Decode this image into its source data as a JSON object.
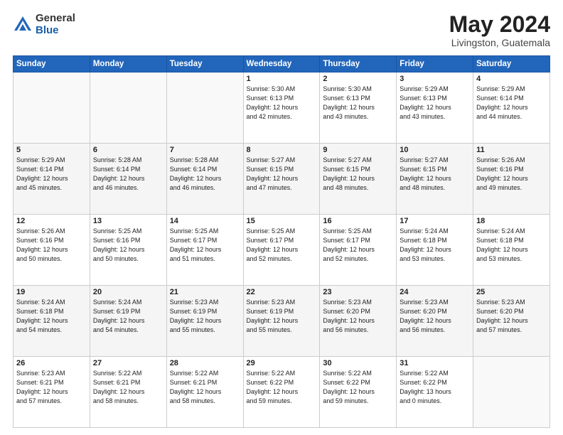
{
  "header": {
    "logo_general": "General",
    "logo_blue": "Blue",
    "month_title": "May 2024",
    "location": "Livingston, Guatemala"
  },
  "weekdays": [
    "Sunday",
    "Monday",
    "Tuesday",
    "Wednesday",
    "Thursday",
    "Friday",
    "Saturday"
  ],
  "weeks": [
    [
      {
        "day": "",
        "info": "",
        "empty": true
      },
      {
        "day": "",
        "info": "",
        "empty": true
      },
      {
        "day": "",
        "info": "",
        "empty": true
      },
      {
        "day": "1",
        "info": "Sunrise: 5:30 AM\nSunset: 6:13 PM\nDaylight: 12 hours\nand 42 minutes."
      },
      {
        "day": "2",
        "info": "Sunrise: 5:30 AM\nSunset: 6:13 PM\nDaylight: 12 hours\nand 43 minutes."
      },
      {
        "day": "3",
        "info": "Sunrise: 5:29 AM\nSunset: 6:13 PM\nDaylight: 12 hours\nand 43 minutes."
      },
      {
        "day": "4",
        "info": "Sunrise: 5:29 AM\nSunset: 6:14 PM\nDaylight: 12 hours\nand 44 minutes."
      }
    ],
    [
      {
        "day": "5",
        "info": "Sunrise: 5:29 AM\nSunset: 6:14 PM\nDaylight: 12 hours\nand 45 minutes."
      },
      {
        "day": "6",
        "info": "Sunrise: 5:28 AM\nSunset: 6:14 PM\nDaylight: 12 hours\nand 46 minutes."
      },
      {
        "day": "7",
        "info": "Sunrise: 5:28 AM\nSunset: 6:14 PM\nDaylight: 12 hours\nand 46 minutes."
      },
      {
        "day": "8",
        "info": "Sunrise: 5:27 AM\nSunset: 6:15 PM\nDaylight: 12 hours\nand 47 minutes."
      },
      {
        "day": "9",
        "info": "Sunrise: 5:27 AM\nSunset: 6:15 PM\nDaylight: 12 hours\nand 48 minutes."
      },
      {
        "day": "10",
        "info": "Sunrise: 5:27 AM\nSunset: 6:15 PM\nDaylight: 12 hours\nand 48 minutes."
      },
      {
        "day": "11",
        "info": "Sunrise: 5:26 AM\nSunset: 6:16 PM\nDaylight: 12 hours\nand 49 minutes."
      }
    ],
    [
      {
        "day": "12",
        "info": "Sunrise: 5:26 AM\nSunset: 6:16 PM\nDaylight: 12 hours\nand 50 minutes."
      },
      {
        "day": "13",
        "info": "Sunrise: 5:25 AM\nSunset: 6:16 PM\nDaylight: 12 hours\nand 50 minutes."
      },
      {
        "day": "14",
        "info": "Sunrise: 5:25 AM\nSunset: 6:17 PM\nDaylight: 12 hours\nand 51 minutes."
      },
      {
        "day": "15",
        "info": "Sunrise: 5:25 AM\nSunset: 6:17 PM\nDaylight: 12 hours\nand 52 minutes."
      },
      {
        "day": "16",
        "info": "Sunrise: 5:25 AM\nSunset: 6:17 PM\nDaylight: 12 hours\nand 52 minutes."
      },
      {
        "day": "17",
        "info": "Sunrise: 5:24 AM\nSunset: 6:18 PM\nDaylight: 12 hours\nand 53 minutes."
      },
      {
        "day": "18",
        "info": "Sunrise: 5:24 AM\nSunset: 6:18 PM\nDaylight: 12 hours\nand 53 minutes."
      }
    ],
    [
      {
        "day": "19",
        "info": "Sunrise: 5:24 AM\nSunset: 6:18 PM\nDaylight: 12 hours\nand 54 minutes."
      },
      {
        "day": "20",
        "info": "Sunrise: 5:24 AM\nSunset: 6:19 PM\nDaylight: 12 hours\nand 54 minutes."
      },
      {
        "day": "21",
        "info": "Sunrise: 5:23 AM\nSunset: 6:19 PM\nDaylight: 12 hours\nand 55 minutes."
      },
      {
        "day": "22",
        "info": "Sunrise: 5:23 AM\nSunset: 6:19 PM\nDaylight: 12 hours\nand 55 minutes."
      },
      {
        "day": "23",
        "info": "Sunrise: 5:23 AM\nSunset: 6:20 PM\nDaylight: 12 hours\nand 56 minutes."
      },
      {
        "day": "24",
        "info": "Sunrise: 5:23 AM\nSunset: 6:20 PM\nDaylight: 12 hours\nand 56 minutes."
      },
      {
        "day": "25",
        "info": "Sunrise: 5:23 AM\nSunset: 6:20 PM\nDaylight: 12 hours\nand 57 minutes."
      }
    ],
    [
      {
        "day": "26",
        "info": "Sunrise: 5:23 AM\nSunset: 6:21 PM\nDaylight: 12 hours\nand 57 minutes."
      },
      {
        "day": "27",
        "info": "Sunrise: 5:22 AM\nSunset: 6:21 PM\nDaylight: 12 hours\nand 58 minutes."
      },
      {
        "day": "28",
        "info": "Sunrise: 5:22 AM\nSunset: 6:21 PM\nDaylight: 12 hours\nand 58 minutes."
      },
      {
        "day": "29",
        "info": "Sunrise: 5:22 AM\nSunset: 6:22 PM\nDaylight: 12 hours\nand 59 minutes."
      },
      {
        "day": "30",
        "info": "Sunrise: 5:22 AM\nSunset: 6:22 PM\nDaylight: 12 hours\nand 59 minutes."
      },
      {
        "day": "31",
        "info": "Sunrise: 5:22 AM\nSunset: 6:22 PM\nDaylight: 13 hours\nand 0 minutes."
      },
      {
        "day": "",
        "info": "",
        "empty": true
      }
    ]
  ]
}
